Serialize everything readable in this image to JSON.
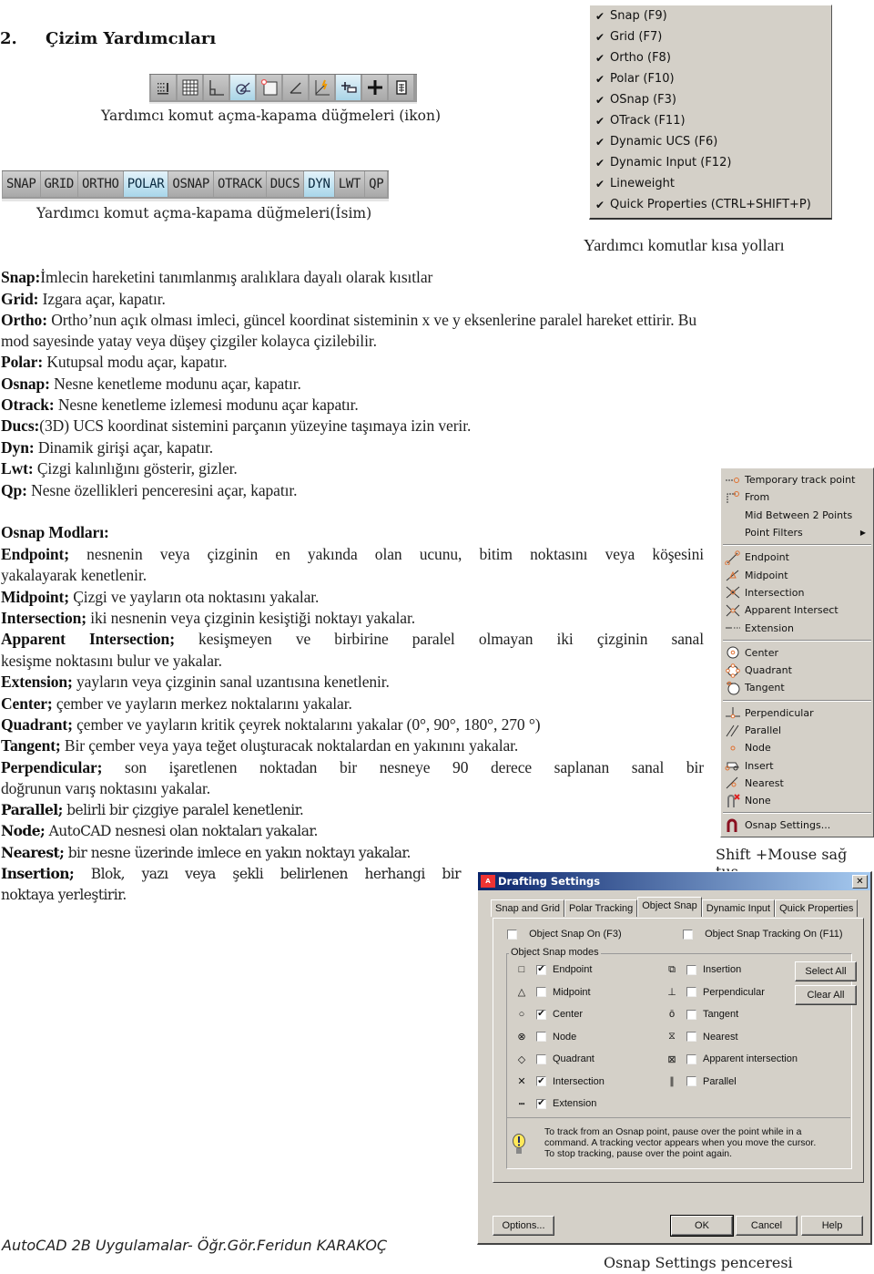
{
  "heading": {
    "number": "2.",
    "title": "Çizim Yardımcıları"
  },
  "icon_toolbar": {
    "buttons": [
      {
        "name": "snap-mode",
        "state": "off"
      },
      {
        "name": "grid-display",
        "state": "off"
      },
      {
        "name": "ortho-mode",
        "state": "off"
      },
      {
        "name": "polar-tracking",
        "state": "on"
      },
      {
        "name": "object-snap",
        "state": "off"
      },
      {
        "name": "object-snap-tracking",
        "state": "off"
      },
      {
        "name": "dynamic-ucs",
        "state": "off"
      },
      {
        "name": "dynamic-input",
        "state": "on"
      },
      {
        "name": "lineweight",
        "state": "off"
      },
      {
        "name": "quick-properties",
        "state": "off"
      }
    ],
    "caption": "Yardımcı komut açma-kapama düğmeleri (ikon)"
  },
  "name_toolbar": {
    "buttons": [
      {
        "label": "SNAP",
        "on": false
      },
      {
        "label": "GRID",
        "on": false
      },
      {
        "label": "ORTHO",
        "on": false
      },
      {
        "label": "POLAR",
        "on": true
      },
      {
        "label": "OSNAP",
        "on": false
      },
      {
        "label": "OTRACK",
        "on": false
      },
      {
        "label": "DUCS",
        "on": false
      },
      {
        "label": "DYN",
        "on": true
      },
      {
        "label": "LWT",
        "on": false
      },
      {
        "label": "QP",
        "on": false
      }
    ],
    "caption": "Yardımcı komut açma-kapama düğmeleri(İsim)"
  },
  "shortcut_menu": {
    "items": [
      "Snap (F9)",
      "Grid (F7)",
      "Ortho (F8)",
      "Polar (F10)",
      "OSnap (F3)",
      "OTrack (F11)",
      "Dynamic UCS (F6)",
      "Dynamic Input (F12)",
      "Lineweight",
      "Quick Properties (CTRL+SHIFT+P)"
    ],
    "check_glyph": "✔",
    "caption": "Yardımcı komutlar kısa yolları"
  },
  "definitions": [
    {
      "term": "Snap:",
      "text": "İmlecin hareketini tanımlanmış aralıklara dayalı olarak kısıtlar"
    },
    {
      "term": "Grid:",
      "text": " Izgara açar, kapatır."
    },
    {
      "term": "Ortho:",
      "text": " Ortho’nun açık olması imleci, güncel koordinat sisteminin x ve y eksenlerine paralel hareket ettirir. Bu"
    },
    {
      "term": "",
      "text": "mod sayesinde yatay veya düşey çizgiler kolayca çizilebilir."
    },
    {
      "term": "Polar:",
      "text": " Kutupsal modu açar, kapatır."
    },
    {
      "term": "Osnap:",
      "text": " Nesne kenetleme modunu açar, kapatır."
    },
    {
      "term": "Otrack:",
      "text": " Nesne kenetleme izlemesi modunu açar kapatır."
    },
    {
      "term": "Ducs:",
      "text": "(3D) UCS koordinat sistemini parçanın yüzeyine taşımaya izin verir."
    },
    {
      "term": "Dyn:",
      "text": " Dinamik girişi açar, kapatır."
    },
    {
      "term": "Lwt:",
      "text": " Çizgi kalınlığını gösterir, gizler."
    },
    {
      "term": "Qp:",
      "text": " Nesne özellikleri penceresini açar, kapatır."
    }
  ],
  "osnap_section": {
    "title": "Osnap Modları:",
    "modes": [
      {
        "term": "Endpoint;",
        "text": " nesnenin veya çizginin en yakında olan ucunu, bitim noktasını veya köşesini",
        "cont": "yakalayarak kenetlenir."
      },
      {
        "term": "Midpoint;",
        "text": " Çizgi ve yayların ota noktasını yakalar."
      },
      {
        "term": "Intersection;",
        "text": " iki nesnenin veya çizginin kesiştiği noktayı yakalar."
      },
      {
        "term": "Apparent Intersection;",
        "text": " kesişmeyen ve birbirine paralel olmayan iki çizginin sanal",
        "cont": "kesişme noktasını bulur ve yakalar."
      },
      {
        "term": "Extension;",
        "text": " yayların veya çizginin sanal uzantısına kenetlenir."
      },
      {
        "term": "Center;",
        "text": " çember ve yayların merkez noktalarını yakalar."
      },
      {
        "term": "Quadrant;",
        "text": " çember ve yayların kritik çeyrek noktalarını yakalar (0°, 90°, 180°, 270 °)"
      },
      {
        "term": "Tangent;",
        "text": " Bir çember veya yaya teğet oluşturacak noktalardan en yakınını yakalar."
      },
      {
        "term": "Perpendicular;",
        "text": " son işaretlenen noktadan bir nesneye 90 derece saplanan sanal bir",
        "cont": "doğrunun varış noktasını yakalar."
      },
      {
        "term": "Parallel;",
        "text": " belirli bir çizgiye paralel kenetlenir."
      },
      {
        "term": "Node;",
        "text": " AutoCAD nesnesi olan noktaları yakalar."
      },
      {
        "term": "Nearest;",
        "text": " bir nesne üzerinde imlece en yakın noktayı yakalar."
      },
      {
        "term": "Insertion;",
        "text": " Blok, yazı veya şekli belirlenen herhangi bir",
        "cont": "noktaya yerleştirir."
      }
    ]
  },
  "context_menu": {
    "top_items": [
      "Temporary track point",
      "From",
      "Mid Between 2 Points",
      "Point Filters"
    ],
    "group1": [
      "Endpoint",
      "Midpoint",
      "Intersection",
      "Apparent Intersect",
      "Extension"
    ],
    "group2": [
      "Center",
      "Quadrant",
      "Tangent"
    ],
    "group3": [
      "Perpendicular",
      "Parallel",
      "Node",
      "Insert",
      "Nearest",
      "None"
    ],
    "settings": "Osnap Settings...",
    "caption": "Shift +Mouse sağ tuş"
  },
  "dialog": {
    "title": "Drafting Settings",
    "tabs": [
      "Snap and Grid",
      "Polar Tracking",
      "Object Snap",
      "Dynamic Input",
      "Quick Properties"
    ],
    "active_tab": "Object Snap",
    "osnap_on": {
      "label": "Object Snap On (F3)",
      "checked": false
    },
    "otrack_on": {
      "label": "Object Snap Tracking On (F11)",
      "checked": false
    },
    "group_label": "Object Snap modes",
    "left_modes": [
      {
        "symbol": "□",
        "label": "Endpoint",
        "checked": true
      },
      {
        "symbol": "△",
        "label": "Midpoint",
        "checked": false
      },
      {
        "symbol": "○",
        "label": "Center",
        "checked": true
      },
      {
        "symbol": "⊗",
        "label": "Node",
        "checked": false
      },
      {
        "symbol": "◇",
        "label": "Quadrant",
        "checked": false
      },
      {
        "symbol": "✕",
        "label": "Intersection",
        "checked": true
      },
      {
        "symbol": "┅",
        "label": "Extension",
        "checked": true
      }
    ],
    "right_modes": [
      {
        "symbol": "⧉",
        "label": "Insertion",
        "checked": false
      },
      {
        "symbol": "⊥",
        "label": "Perpendicular",
        "checked": false
      },
      {
        "symbol": "ō",
        "label": "Tangent",
        "checked": false
      },
      {
        "symbol": "⧖",
        "label": "Nearest",
        "checked": false
      },
      {
        "symbol": "⊠",
        "label": "Apparent intersection",
        "checked": false
      },
      {
        "symbol": "∥",
        "label": "Parallel",
        "checked": false
      }
    ],
    "select_all": "Select All",
    "clear_all": "Clear All",
    "info_lines": [
      "To track from an Osnap point, pause over the point while in a",
      "command.  A tracking vector appears when you move the cursor.",
      "To stop tracking, pause over the point again."
    ],
    "buttons": {
      "options": "Options...",
      "ok": "OK",
      "cancel": "Cancel",
      "help": "Help"
    },
    "caption": "Osnap Settings penceresi"
  },
  "footer": "AutoCAD 2B Uygulamalar- Öğr.Gör.Feridun KARAKOÇ"
}
